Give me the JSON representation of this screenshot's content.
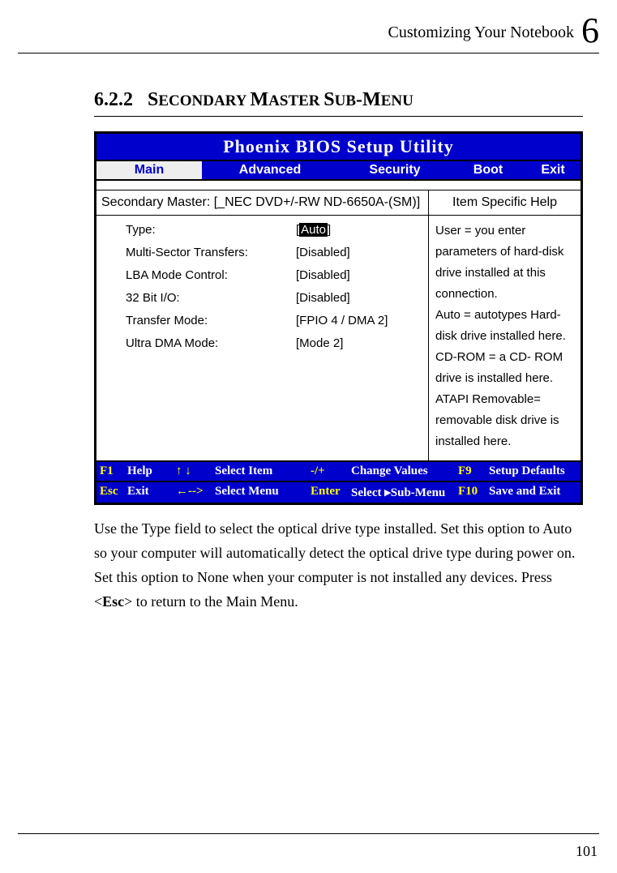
{
  "running_head": {
    "title": "Customizing Your Notebook",
    "chapter": "6"
  },
  "section": {
    "number": "6.2.2",
    "title_pre": "S",
    "title_mid": "ECONDARY ",
    "title_m2": "M",
    "title_mid2": "ASTER ",
    "title_s": "S",
    "title_mid3": "UB",
    "title_dash": "-",
    "title_m3": "M",
    "title_end": "ENU"
  },
  "bios": {
    "title": "Phoenix BIOS Setup Utility",
    "tabs": {
      "main": "Main",
      "advanced": "Advanced",
      "security": "Security",
      "boot": "Boot",
      "exit": "Exit"
    },
    "subheader": "Secondary Master: [_NEC DVD+/-RW ND-6650A-(SM)]",
    "help_title": "Item Specific Help",
    "settings": [
      {
        "label": "Type:",
        "value_pre": "[",
        "value_core": "Auto",
        "value_post": "]",
        "highlight": true
      },
      {
        "label": "",
        "value": ""
      },
      {
        "label": "Multi-Sector Transfers:",
        "value": "[Disabled]"
      },
      {
        "label": "LBA Mode Control:",
        "value": "[Disabled]"
      },
      {
        "label": "32 Bit I/O:",
        "value": "[Disabled]"
      },
      {
        "label": "Transfer Mode:",
        "value": "[FPIO 4 / DMA 2]"
      },
      {
        "label": "Ultra DMA Mode:",
        "value": "[Mode 2]"
      }
    ],
    "help_text": "User = you enter parameters of hard-disk drive installed at this connection.\nAuto = autotypes Hard-disk drive installed here.\nCD-ROM = a CD- ROM drive is installed here.\nATAPI Removable= removable disk drive is installed here.",
    "footer": {
      "row1": {
        "k1": "F1",
        "a1": "Help",
        "k2": "↑ ↓",
        "a2": "Select Item",
        "k3": "-/+",
        "a3": "Change Values",
        "k4": "F9",
        "a4": "Setup Defaults"
      },
      "row2": {
        "k1": "Esc",
        "a1": "Exit",
        "k2": "←-->",
        "a2": "Select Menu",
        "k3": "Enter",
        "a3": "Select ▸Sub-Menu",
        "k4": "F10",
        "a4": "Save and Exit"
      }
    }
  },
  "paragraph": "Use the Type field to select the optical drive type installed. Set this option to Auto so your computer will automatically detect the optical drive type during power on. Set this option to None when your computer is not installed any devices. Press <Esc> to return to the Main Menu.",
  "page_number": "101"
}
